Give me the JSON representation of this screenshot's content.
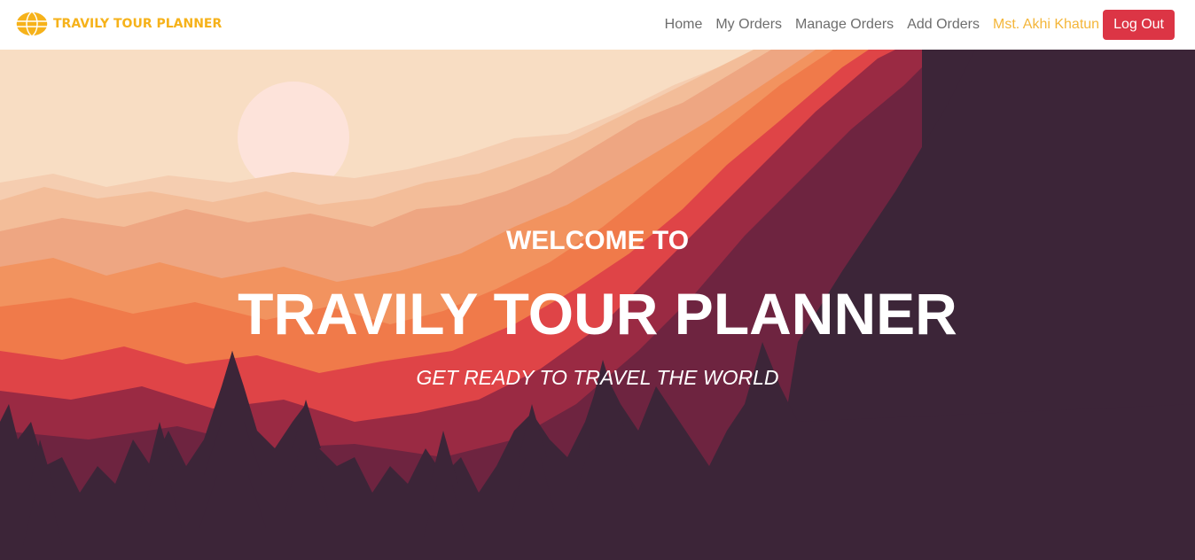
{
  "brand": {
    "name": "TRAVILY TOUR PLANNER",
    "logo_icon": "globe-icon",
    "color": "#f6b21a"
  },
  "nav": {
    "links": [
      "Home",
      "My Orders",
      "Manage Orders",
      "Add Orders"
    ],
    "user_name": "Mst. Akhi Khatun",
    "logout_label": "Log Out"
  },
  "hero": {
    "welcome": "WELCOME TO",
    "title": "TRAVILY TOUR PLANNER",
    "subtitle": "GET READY TO TRAVEL THE WORLD"
  },
  "colors": {
    "logout_button": "#dc3545",
    "user_name": "#f4b63a",
    "hero_dark": "#3c2538"
  }
}
